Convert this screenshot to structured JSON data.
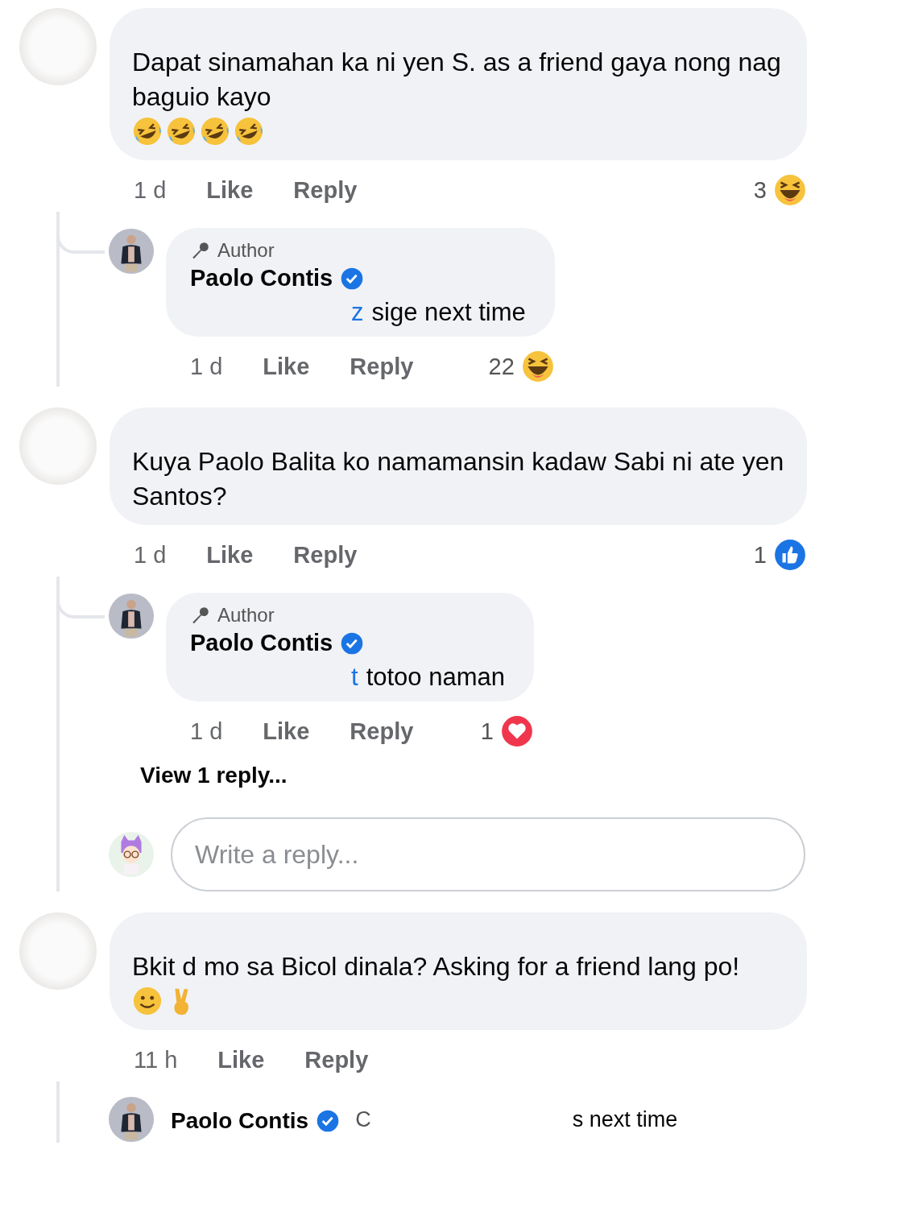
{
  "comments": [
    {
      "text": "Dapat sinamahan ka ni yen S. as a friend gaya nong nag baguio kayo",
      "emojis": [
        {
          "kind": "rofl"
        },
        {
          "kind": "rofl"
        },
        {
          "kind": "rofl"
        },
        {
          "kind": "rofl"
        }
      ],
      "time": "1 d",
      "like": "Like",
      "reply": "Reply",
      "reaction": {
        "count": "3",
        "kind": "haha"
      },
      "replies": [
        {
          "badge": "Author",
          "name": "Paolo Contis",
          "verified": true,
          "mention": "z",
          "text": "sige next time",
          "time": "1 d",
          "like": "Like",
          "reply": "Reply",
          "reaction": {
            "count": "22",
            "kind": "haha"
          }
        }
      ]
    },
    {
      "text": "Kuya Paolo Balita ko namamansin kadaw Sabi ni ate yen Santos?",
      "time": "1 d",
      "like": "Like",
      "reply": "Reply",
      "reaction": {
        "count": "1",
        "kind": "like"
      },
      "replies": [
        {
          "badge": "Author",
          "name": "Paolo Contis",
          "verified": true,
          "mention": "t",
          "text": "totoo naman",
          "time": "1 d",
          "like": "Like",
          "reply": "Reply",
          "reaction": {
            "count": "1",
            "kind": "love"
          }
        }
      ],
      "view_replies": "View 1 reply...",
      "reply_box": {
        "placeholder": "Write a reply..."
      }
    },
    {
      "text": "Bkit d mo sa Bicol dinala? Asking for a friend lang po!",
      "emojis": [
        {
          "kind": "smile"
        },
        {
          "kind": "peace"
        }
      ],
      "time": "11 h",
      "like": "Like",
      "reply": "Reply",
      "reply_preview": {
        "name": "Paolo Contis",
        "verified": true,
        "mention": "C",
        "text": "s next time"
      }
    }
  ]
}
